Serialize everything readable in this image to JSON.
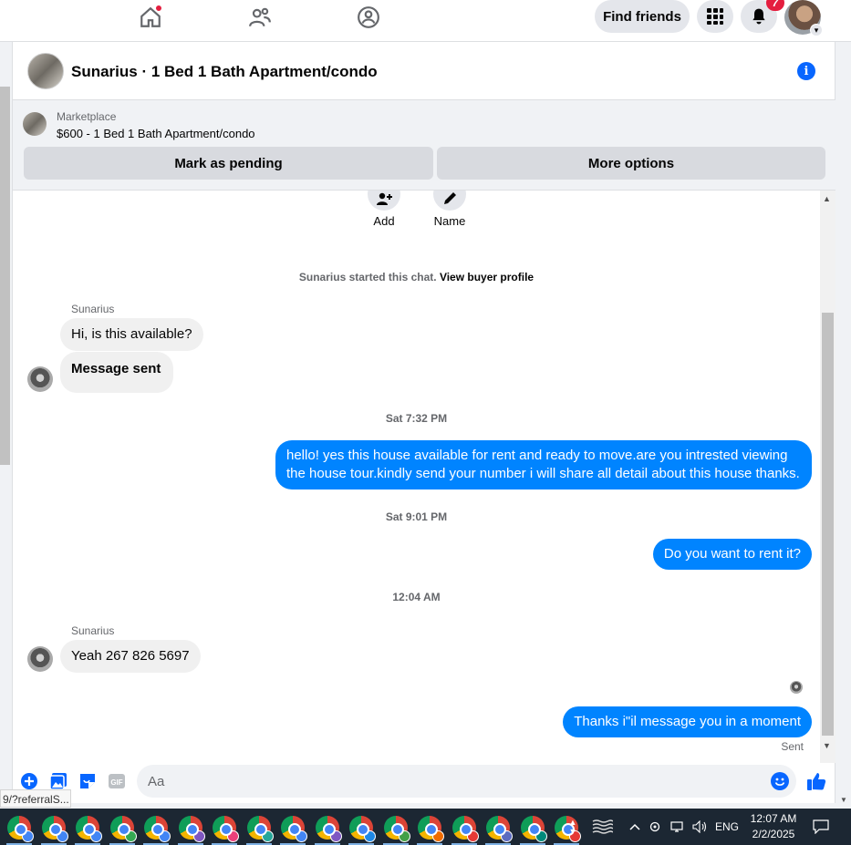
{
  "topbar": {
    "find_friends_label": "Find friends",
    "notification_count": "7"
  },
  "chat": {
    "title": "Sunarius · 1 Bed 1 Bath Apartment/condo",
    "marketplace": {
      "label": "Marketplace",
      "listing": "$600 - 1 Bed 1 Bath Apartment/condo",
      "mark_pending_label": "Mark as pending",
      "more_options_label": "More options"
    },
    "actions": [
      {
        "label": "Add",
        "icon": "add-person-icon"
      },
      {
        "label": "Name",
        "icon": "pencil-icon"
      }
    ],
    "system_message": {
      "text": "Sunarius started this chat.",
      "link": "View buyer profile"
    },
    "messages": {
      "sender_1": "Sunarius",
      "in_1": "Hi, is this available?",
      "in_2": "Message sent",
      "ts_1": "Sat 7:32 PM",
      "out_1": "hello! yes this house available for rent and ready to move.are you intrested viewing the house tour.kindly send your number i will share all detail about this house thanks.",
      "ts_2": "Sat 9:01 PM",
      "out_2": "Do you want to rent it?",
      "ts_3": "12:04 AM",
      "sender_2": "Sunarius",
      "in_3": "Yeah 267 826 5697",
      "out_3": "Thanks i\"il message you in a moment",
      "status": "Sent"
    },
    "composer": {
      "placeholder": "Aa",
      "icons": [
        "plus-icon",
        "photo-icon",
        "sticker-icon",
        "gif-icon",
        "emoji-icon",
        "like-icon"
      ]
    }
  },
  "status_url": "9/?referralS...",
  "taskbar": {
    "language": "ENG",
    "time": "12:07 AM",
    "date": "2/2/2025",
    "profile_colors": [
      "#4285f4",
      "#4285f4",
      "#4285f4",
      "#34a853",
      "#4285f4",
      "#7e57c2",
      "#ec407a",
      "#26a69a",
      "#4285f4",
      "#7e57c2",
      "#1e88e5",
      "#43a047",
      "#ef6c00",
      "#e53935",
      "#5c6bc0",
      "#00897b",
      "#e53935"
    ]
  },
  "colors": {
    "messenger_blue": "#0084ff",
    "fb_blue": "#0866ff",
    "notification_red": "#e41e3f"
  }
}
